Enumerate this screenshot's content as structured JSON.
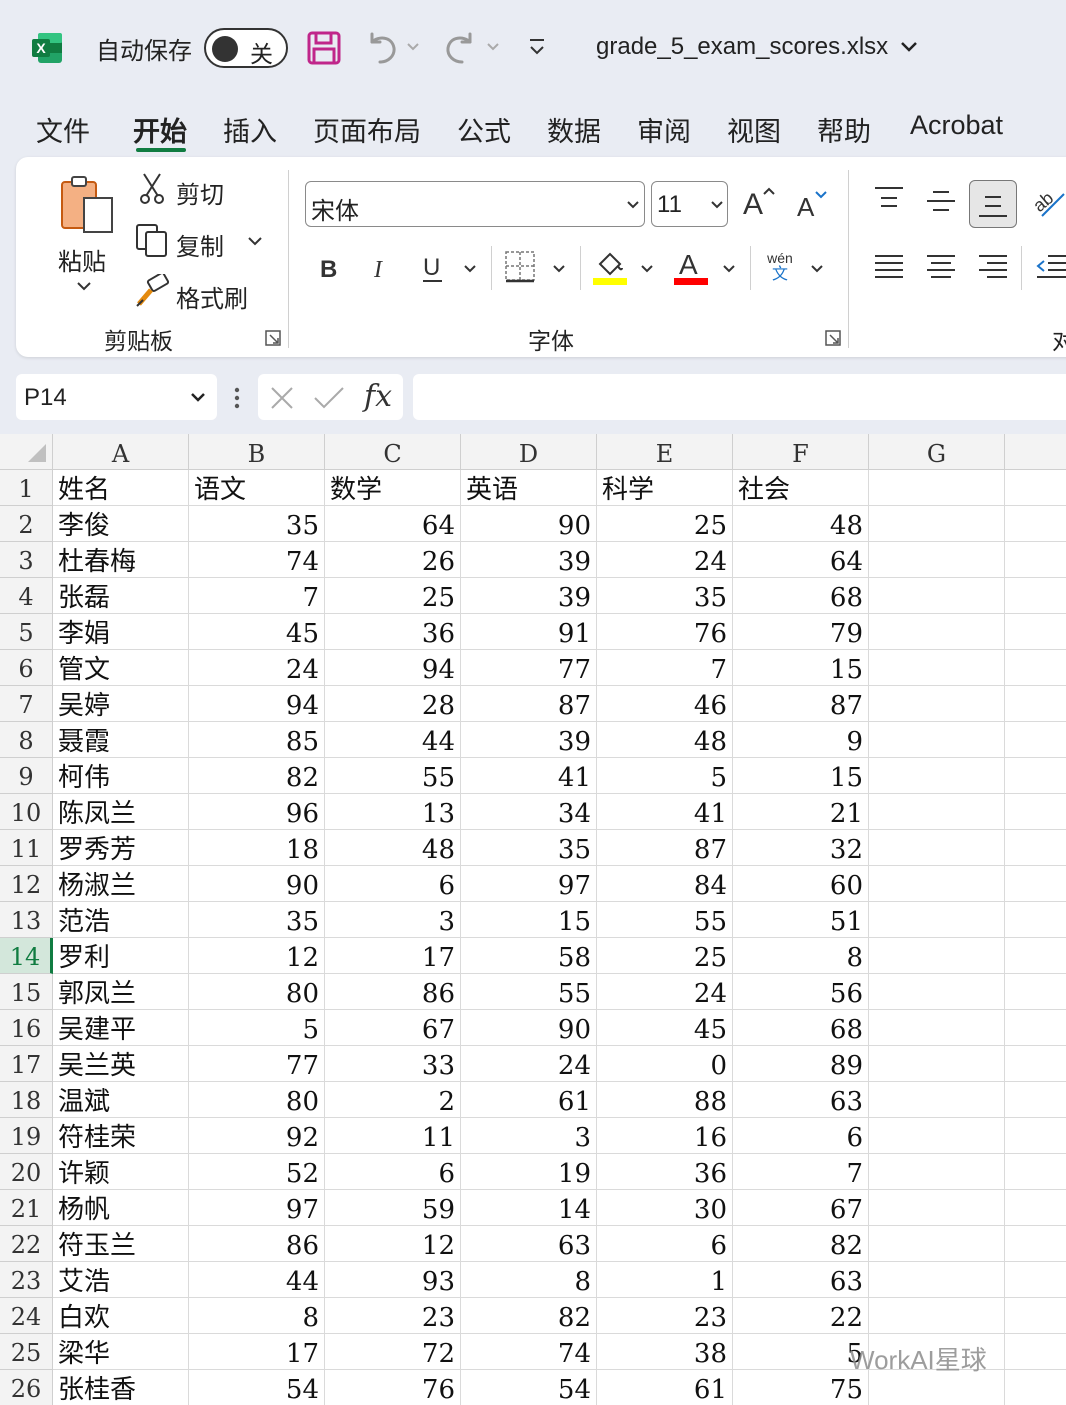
{
  "titlebar": {
    "autosave_label": "自动保存",
    "autosave_state": "关",
    "filename": "grade_5_exam_scores.xlsx",
    "app_icon": "excel-logo-icon",
    "brand_color": "#107c41"
  },
  "tabs": [
    {
      "label": "文件"
    },
    {
      "label": "开始"
    },
    {
      "label": "插入"
    },
    {
      "label": "页面布局"
    },
    {
      "label": "公式"
    },
    {
      "label": "数据"
    },
    {
      "label": "审阅"
    },
    {
      "label": "视图"
    },
    {
      "label": "帮助"
    },
    {
      "label": "Acrobat"
    }
  ],
  "active_tab": "开始",
  "ribbon": {
    "clipboard": {
      "paste_label": "粘贴",
      "cut_label": "剪切",
      "copy_label": "复制",
      "format_painter_label": "格式刷",
      "group_label": "剪贴板"
    },
    "font": {
      "font_name": "宋体",
      "font_size": "11",
      "phonetic_top": "wén",
      "phonetic_bottom": "文",
      "group_label": "字体",
      "highlight_color": "#ffff00",
      "font_color": "#ff0000"
    },
    "alignment": {
      "group_label_partial": "对"
    }
  },
  "formula_bar": {
    "name_box": "P14",
    "fx_label": "fx",
    "formula": ""
  },
  "sheet": {
    "columns": [
      "A",
      "B",
      "C",
      "D",
      "E",
      "F",
      "G"
    ],
    "active_row": 14,
    "rows": [
      {
        "n": "1",
        "cells": [
          "姓名",
          "语文",
          "数学",
          "英语",
          "科学",
          "社会"
        ]
      },
      {
        "n": "2",
        "cells": [
          "李俊",
          "35",
          "64",
          "90",
          "25",
          "48"
        ]
      },
      {
        "n": "3",
        "cells": [
          "杜春梅",
          "74",
          "26",
          "39",
          "24",
          "64"
        ]
      },
      {
        "n": "4",
        "cells": [
          "张磊",
          "7",
          "25",
          "39",
          "35",
          "68"
        ]
      },
      {
        "n": "5",
        "cells": [
          "李娟",
          "45",
          "36",
          "91",
          "76",
          "79"
        ]
      },
      {
        "n": "6",
        "cells": [
          "管文",
          "24",
          "94",
          "77",
          "7",
          "15"
        ]
      },
      {
        "n": "7",
        "cells": [
          "吴婷",
          "94",
          "28",
          "87",
          "46",
          "87"
        ]
      },
      {
        "n": "8",
        "cells": [
          "聂霞",
          "85",
          "44",
          "39",
          "48",
          "9"
        ]
      },
      {
        "n": "9",
        "cells": [
          "柯伟",
          "82",
          "55",
          "41",
          "5",
          "15"
        ]
      },
      {
        "n": "10",
        "cells": [
          "陈凤兰",
          "96",
          "13",
          "34",
          "41",
          "21"
        ]
      },
      {
        "n": "11",
        "cells": [
          "罗秀芳",
          "18",
          "48",
          "35",
          "87",
          "32"
        ]
      },
      {
        "n": "12",
        "cells": [
          "杨淑兰",
          "90",
          "6",
          "97",
          "84",
          "60"
        ]
      },
      {
        "n": "13",
        "cells": [
          "范浩",
          "35",
          "3",
          "15",
          "55",
          "51"
        ]
      },
      {
        "n": "14",
        "cells": [
          "罗利",
          "12",
          "17",
          "58",
          "25",
          "8"
        ]
      },
      {
        "n": "15",
        "cells": [
          "郭凤兰",
          "80",
          "86",
          "55",
          "24",
          "56"
        ]
      },
      {
        "n": "16",
        "cells": [
          "吴建平",
          "5",
          "67",
          "90",
          "45",
          "68"
        ]
      },
      {
        "n": "17",
        "cells": [
          "吴兰英",
          "77",
          "33",
          "24",
          "0",
          "89"
        ]
      },
      {
        "n": "18",
        "cells": [
          "温斌",
          "80",
          "2",
          "61",
          "88",
          "63"
        ]
      },
      {
        "n": "19",
        "cells": [
          "符桂荣",
          "92",
          "11",
          "3",
          "16",
          "6"
        ]
      },
      {
        "n": "20",
        "cells": [
          "许颖",
          "52",
          "6",
          "19",
          "36",
          "7"
        ]
      },
      {
        "n": "21",
        "cells": [
          "杨帆",
          "97",
          "59",
          "14",
          "30",
          "67"
        ]
      },
      {
        "n": "22",
        "cells": [
          "符玉兰",
          "86",
          "12",
          "63",
          "6",
          "82"
        ]
      },
      {
        "n": "23",
        "cells": [
          "艾浩",
          "44",
          "93",
          "8",
          "1",
          "63"
        ]
      },
      {
        "n": "24",
        "cells": [
          "白欢",
          "8",
          "23",
          "82",
          "23",
          "22"
        ]
      },
      {
        "n": "25",
        "cells": [
          "梁华",
          "17",
          "72",
          "74",
          "38",
          "5"
        ]
      },
      {
        "n": "26",
        "cells": [
          "张桂香",
          "54",
          "76",
          "54",
          "61",
          "75"
        ]
      }
    ]
  },
  "watermark": "WorkAI星球"
}
